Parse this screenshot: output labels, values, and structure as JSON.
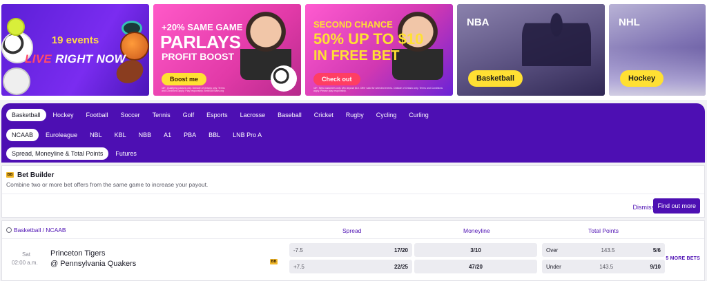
{
  "banners": {
    "live": {
      "events": "19 events",
      "live": "LIVE",
      "right_now": "RIGHT NOW"
    },
    "parlays": {
      "line1": "+20% SAME GAME",
      "line2": "PARLAYS",
      "line3": "PROFIT BOOST",
      "cta": "Boost me",
      "fine_print": "18+. Qualifying passes only. Outside of Ontario only. Terms and Conditions apply. Play responsibly. BetMGMSlabs.org"
    },
    "second_chance": {
      "line1": "SECOND CHANCE",
      "line2": "50% UP TO $10",
      "line3": "IN FREE BET",
      "cta": "Check out",
      "fine_print": "18+. New customers only. Min deposit $10. Offer valid for selected events. Outside of Ontario only. Terms and Conditions apply. Please play responsibly."
    },
    "nba": {
      "title": "NBA",
      "cta": "Basketball"
    },
    "nhl": {
      "title": "NHL",
      "cta": "Hockey"
    }
  },
  "sports_tabs": [
    "Basketball",
    "Hockey",
    "Football",
    "Soccer",
    "Tennis",
    "Golf",
    "Esports",
    "Lacrosse",
    "Baseball",
    "Cricket",
    "Rugby",
    "Cycling",
    "Curling"
  ],
  "league_tabs": [
    "NCAAB",
    "Euroleague",
    "NBL",
    "KBL",
    "NBB",
    "A1",
    "PBA",
    "BBL",
    "LNB Pro A"
  ],
  "market_tabs": [
    "Spread, Moneyline & Total Points",
    "Futures"
  ],
  "bet_builder": {
    "badge": "BB",
    "title": "Bet Builder",
    "subtitle": "Combine two or more bet offers from the same game to increase your payout.",
    "dismiss": "Dismiss",
    "find_out": "Find out more"
  },
  "table": {
    "breadcrumb": "Basketball / NCAAB",
    "col_spread": "Spread",
    "col_moneyline": "Moneyline",
    "col_total": "Total Points",
    "event": {
      "day": "Sat",
      "time": "02:00 a.m.",
      "team1": "Princeton Tigers",
      "team2": "@ Pennsylvania Quakers",
      "badge": "BB",
      "spread": [
        {
          "label": "-7.5",
          "price": "17/20"
        },
        {
          "label": "+7.5",
          "price": "22/25"
        }
      ],
      "moneyline": [
        {
          "price": "3/10"
        },
        {
          "price": "47/20"
        }
      ],
      "total": [
        {
          "label": "Over",
          "line": "143.5",
          "price": "5/6"
        },
        {
          "label": "Under",
          "line": "143.5",
          "price": "9/10"
        }
      ],
      "more": "5 MORE BETS"
    }
  },
  "colors": {
    "brand_purple": "#4d0fb3",
    "cta_yellow": "#ffe033",
    "bb_badge": "#f2b82a"
  }
}
